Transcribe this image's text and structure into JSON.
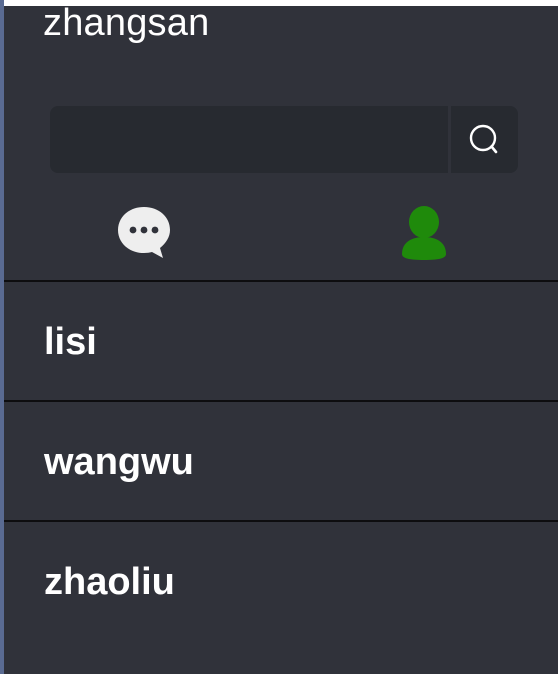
{
  "user": {
    "name": "zhangsan"
  },
  "search": {
    "value": "",
    "placeholder": "",
    "icon": "search-icon"
  },
  "tabs": [
    {
      "id": "chat",
      "icon": "chat-bubble-icon",
      "active": false,
      "color": "#eeeeee"
    },
    {
      "id": "contacts",
      "icon": "person-icon",
      "active": true,
      "color": "#1f8a0b"
    }
  ],
  "contacts": [
    {
      "name": "lisi"
    },
    {
      "name": "wangwu"
    },
    {
      "name": "zhaoliu"
    }
  ],
  "theme": {
    "panel_bg": "#30323a",
    "input_bg": "#272a30",
    "divider": "#0d0d0f",
    "text": "#ffffff",
    "active_tab": "#1f8a0b"
  }
}
